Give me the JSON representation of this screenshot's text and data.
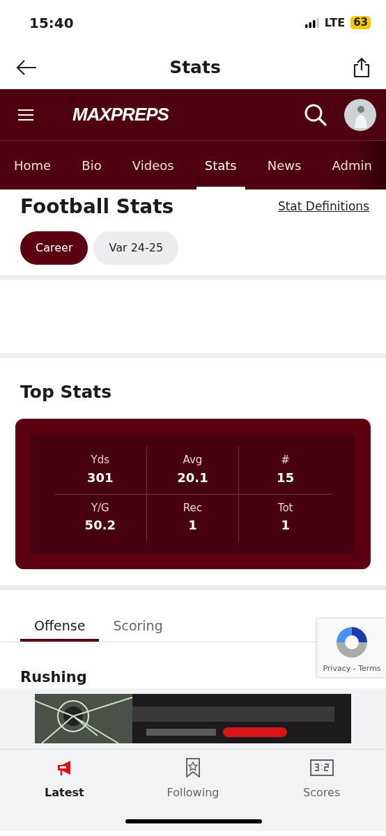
{
  "status_bar": {
    "time": "15:40",
    "network": "LTE",
    "battery": "63"
  },
  "app_header": {
    "title": "Stats"
  },
  "site_header": {
    "logo": "MAXPREPS"
  },
  "nav_tabs": [
    {
      "label": "Home",
      "selected": false
    },
    {
      "label": "Bio",
      "selected": false
    },
    {
      "label": "Videos",
      "selected": false
    },
    {
      "label": "Stats",
      "selected": true
    },
    {
      "label": "News",
      "selected": false
    },
    {
      "label": "Admin",
      "selected": false
    }
  ],
  "heading": "Football Stats",
  "definitions_link": "Stat Definitions",
  "seasons": [
    {
      "label": "Career",
      "selected": true
    },
    {
      "label": "Var 24-25",
      "selected": false
    }
  ],
  "top_stats": {
    "title": "Top Stats",
    "items": [
      {
        "label": "Yds",
        "value": "301"
      },
      {
        "label": "Avg",
        "value": "20.1"
      },
      {
        "label": "#",
        "value": "15"
      },
      {
        "label": "Y/G",
        "value": "50.2"
      },
      {
        "label": "Rec",
        "value": "1"
      },
      {
        "label": "Tot",
        "value": "1"
      }
    ]
  },
  "category_tabs": [
    {
      "label": "Offense",
      "selected": true
    },
    {
      "label": "Scoring",
      "selected": false
    }
  ],
  "section_title": "Rushing",
  "recaptcha": {
    "links": "Privacy - Terms"
  },
  "bottom_tabs": [
    {
      "label": "Latest",
      "selected": true
    },
    {
      "label": "Following",
      "selected": false
    },
    {
      "label": "Scores",
      "selected": false
    }
  ]
}
